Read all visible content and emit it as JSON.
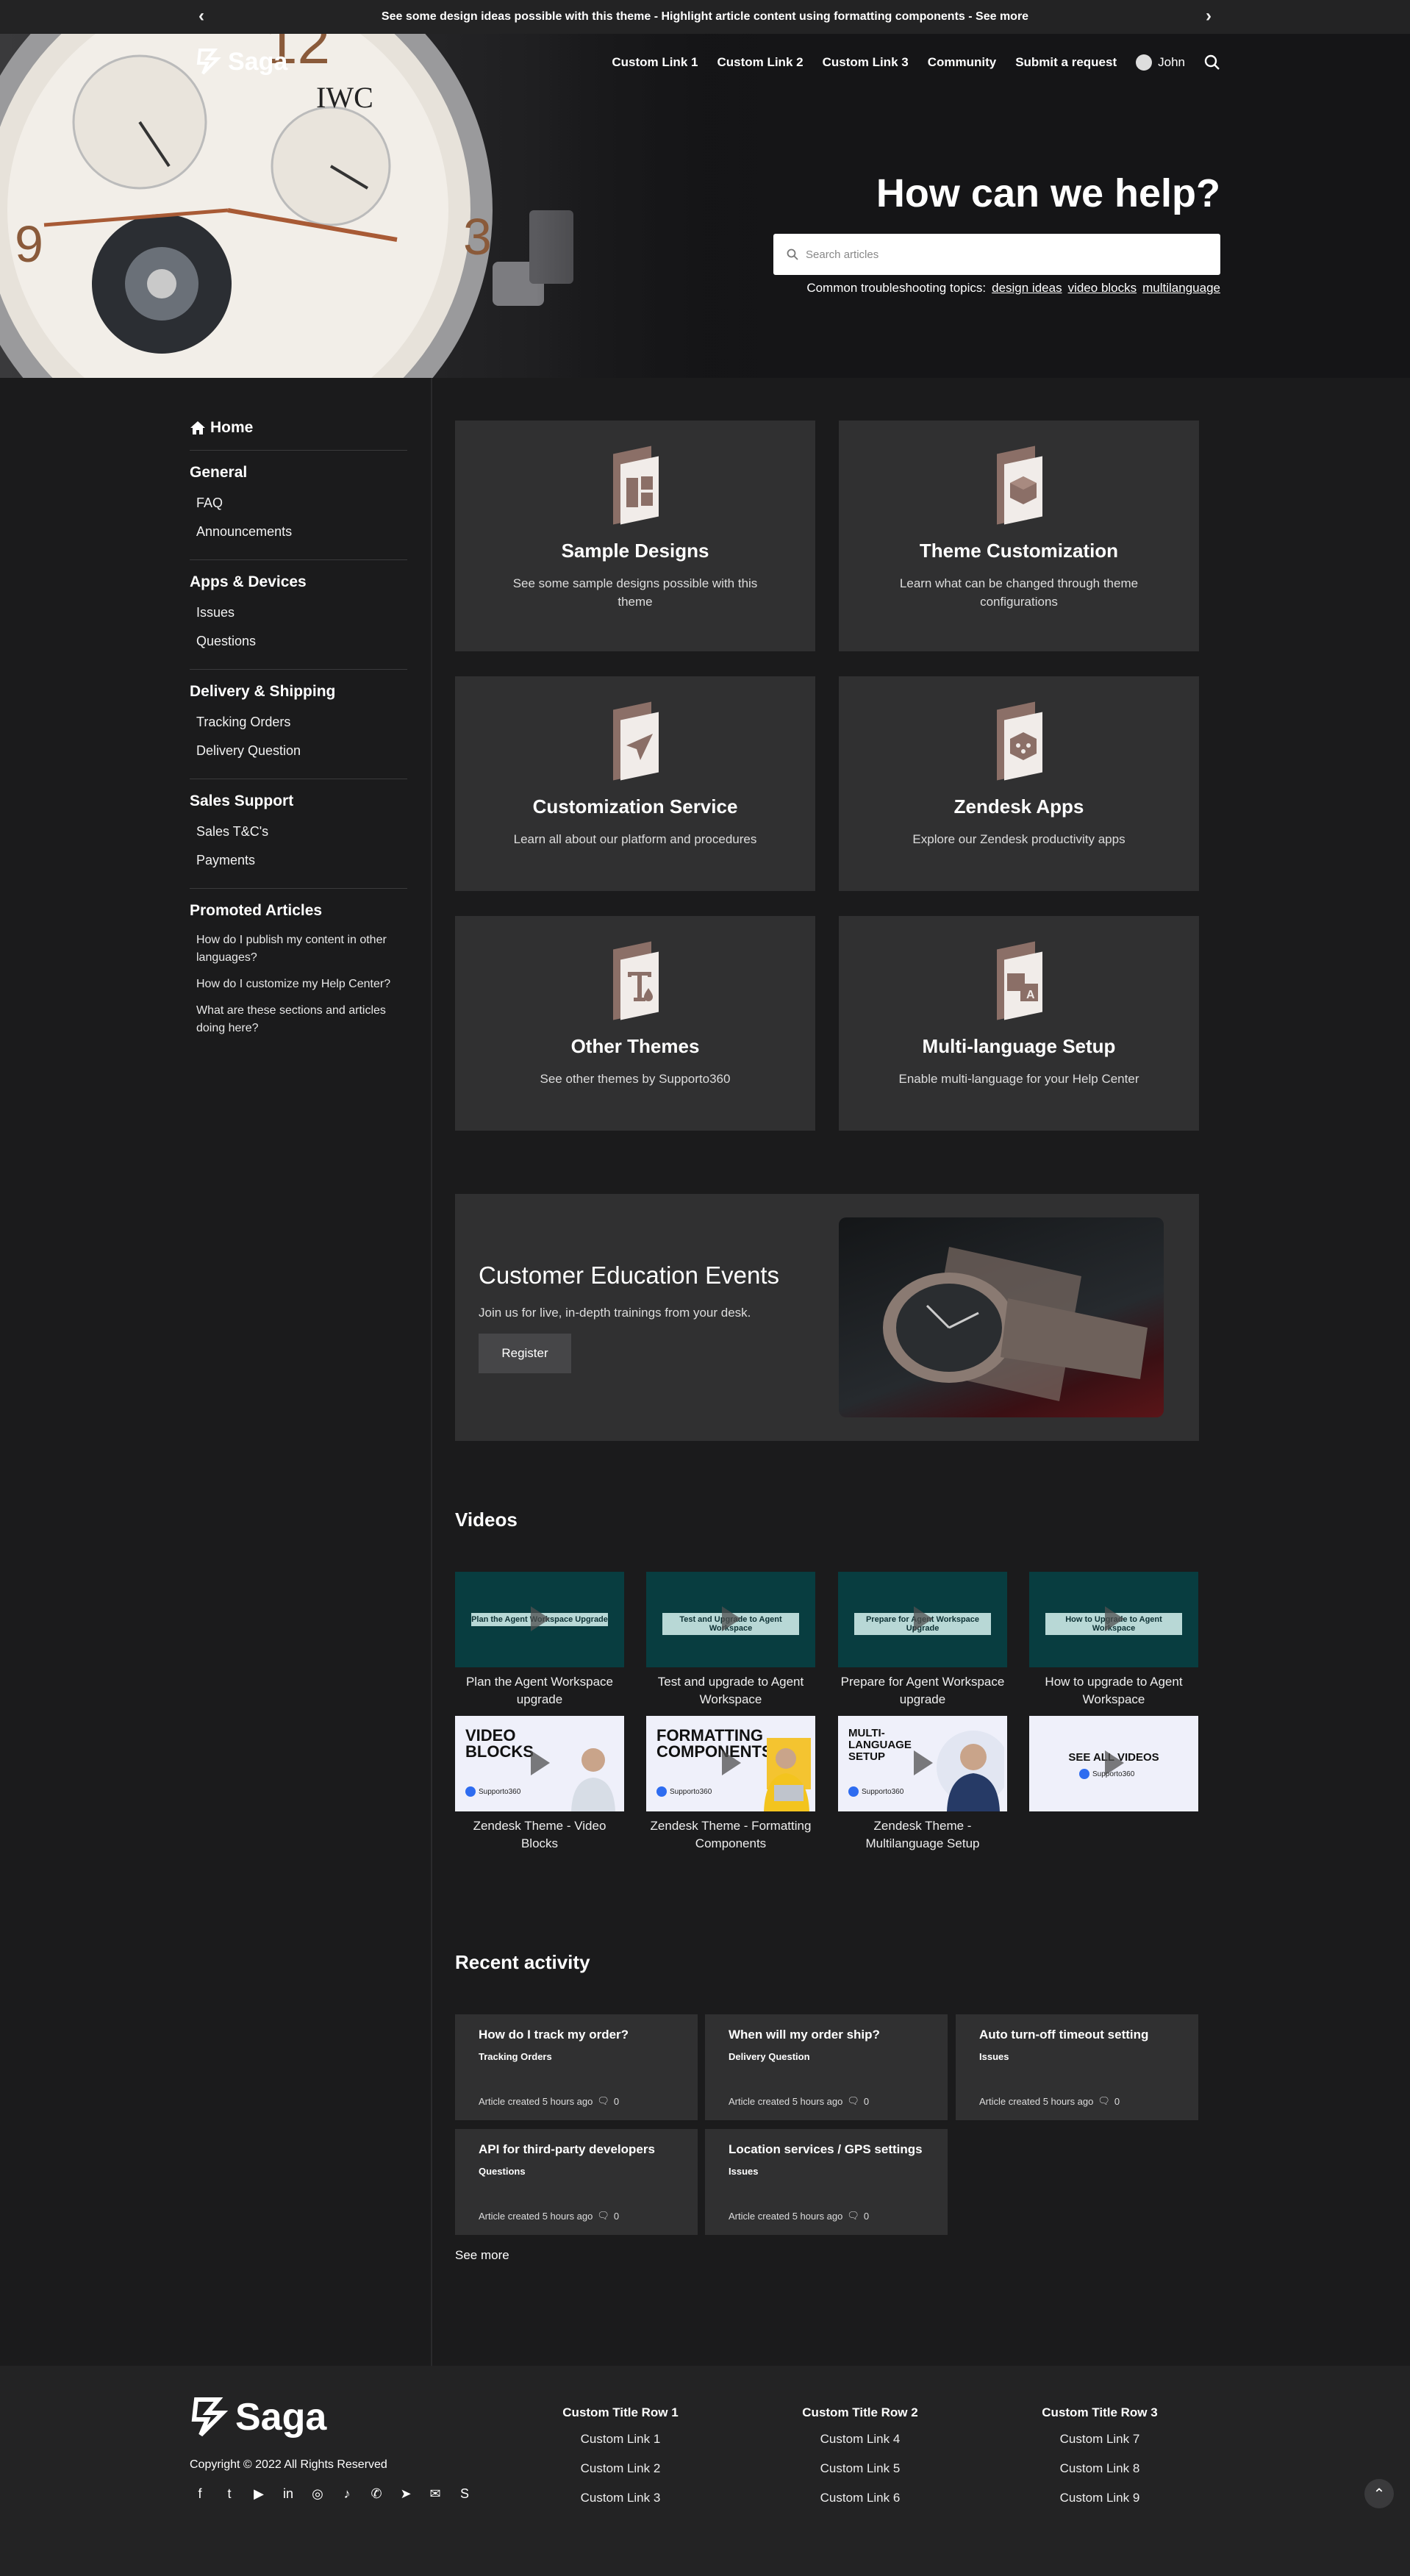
{
  "announcement": {
    "text": "See some design ideas possible with this theme - Highlight article content using formatting components - See more"
  },
  "header": {
    "logo": "Saga",
    "nav": [
      "Custom Link 1",
      "Custom Link 2",
      "Custom Link 3",
      "Community",
      "Submit a request"
    ],
    "user": "John"
  },
  "hero": {
    "title": "How can we help?",
    "search_placeholder": "Search articles",
    "topics_label": "Common troubleshooting topics:",
    "topics": [
      "design ideas",
      "video blocks",
      "multilanguage"
    ]
  },
  "sidebar": {
    "home": "Home",
    "sections": [
      {
        "title": "General",
        "items": [
          "FAQ",
          "Announcements"
        ]
      },
      {
        "title": "Apps & Devices",
        "items": [
          "Issues",
          "Questions"
        ]
      },
      {
        "title": "Delivery & Shipping",
        "items": [
          "Tracking Orders",
          "Delivery Question"
        ]
      },
      {
        "title": "Sales Support",
        "items": [
          "Sales T&C's",
          "Payments"
        ]
      }
    ],
    "promoted_title": "Promoted Articles",
    "promoted": [
      "How do I publish my content in other languages?",
      "How do I customize my Help Center?",
      "What are these sections and articles doing here?"
    ]
  },
  "cards": [
    {
      "title": "Sample Designs",
      "desc": "See some sample designs possible with this theme",
      "icon": "layout-icon"
    },
    {
      "title": "Theme Customization",
      "desc": "Learn what can be changed through theme configurations",
      "icon": "cube-icon"
    },
    {
      "title": "Customization Service",
      "desc": "Learn all about our platform and procedures",
      "icon": "paper-plane-icon"
    },
    {
      "title": "Zendesk Apps",
      "desc": "Explore our Zendesk productivity apps",
      "icon": "apps-icon"
    },
    {
      "title": "Other Themes",
      "desc": "See other themes by Supporto360",
      "icon": "text-drop-icon"
    },
    {
      "title": "Multi-language Setup",
      "desc": "Enable multi-language for your Help Center",
      "icon": "translate-icon"
    }
  ],
  "events": {
    "title": "Customer Education Events",
    "desc": "Join us for live, in-depth trainings from your desk.",
    "button": "Register"
  },
  "videos": {
    "title": "Videos",
    "items": [
      {
        "thumb": "Plan the Agent Workspace Upgrade",
        "caption": "Plan the Agent Workspace upgrade"
      },
      {
        "thumb": "Test and Upgrade to Agent Workspace",
        "caption": "Test and upgrade to Agent Workspace"
      },
      {
        "thumb": "Prepare for Agent Workspace Upgrade",
        "caption": "Prepare for Agent Workspace upgrade"
      },
      {
        "thumb": "How to Upgrade to Agent Workspace",
        "caption": "How to upgrade to Agent Workspace"
      },
      {
        "thumb": "VIDEO BLOCKS",
        "badge": "Supporto360",
        "caption": "Zendesk Theme - Video Blocks"
      },
      {
        "thumb": "FORMATTING COMPONENTS",
        "badge": "Supporto360",
        "caption": "Zendesk Theme - Formatting Components"
      },
      {
        "thumb": "MULTI-LANGUAGE SETUP",
        "badge": "Supporto360",
        "caption": "Zendesk Theme - Multilanguage Setup"
      },
      {
        "thumb": "SEE ALL VIDEOS",
        "badge": "Supporto360",
        "caption": ""
      }
    ]
  },
  "activity": {
    "title": "Recent activity",
    "items": [
      {
        "title": "How do I track my order?",
        "section": "Tracking Orders",
        "meta": "Article created 5 hours ago",
        "comments": "0"
      },
      {
        "title": "When will my order ship?",
        "section": "Delivery Question",
        "meta": "Article created 5 hours ago",
        "comments": "0"
      },
      {
        "title": "Auto turn-off timeout setting",
        "section": "Issues",
        "meta": "Article created 5 hours ago",
        "comments": "0"
      },
      {
        "title": "API for third-party developers",
        "section": "Questions",
        "meta": "Article created 5 hours ago",
        "comments": "0"
      },
      {
        "title": "Location services / GPS settings",
        "section": "Issues",
        "meta": "Article created 5 hours ago",
        "comments": "0"
      }
    ],
    "see_more": "See more"
  },
  "footer": {
    "logo": "Saga",
    "copyright": "Copyright © 2022 All Rights Reserved",
    "columns": [
      {
        "title": "Custom Title Row 1",
        "links": [
          "Custom Link 1",
          "Custom Link 2",
          "Custom Link 3"
        ]
      },
      {
        "title": "Custom Title Row 2",
        "links": [
          "Custom Link 4",
          "Custom Link 5",
          "Custom Link 6"
        ]
      },
      {
        "title": "Custom Title Row 3",
        "links": [
          "Custom Link 7",
          "Custom Link 8",
          "Custom Link 9"
        ]
      }
    ],
    "social": [
      "facebook-icon",
      "twitter-icon",
      "youtube-icon",
      "linkedin-icon",
      "instagram-icon",
      "tiktok-icon",
      "whatsapp-icon",
      "telegram-icon",
      "messenger-icon",
      "skype-icon"
    ]
  }
}
